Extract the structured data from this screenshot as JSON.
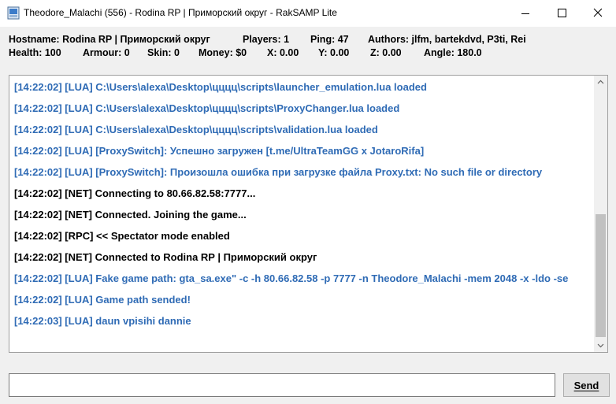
{
  "window": {
    "title": "Theodore_Malachi (556) - Rodina RP | Приморский округ - RakSAMP Lite"
  },
  "info": {
    "hostname": "Hostname: Rodina RP | Приморский округ",
    "players": "Players: 1",
    "ping": "Ping: 47",
    "authors": "Authors: jlfm, bartekdvd, P3ti, Rei",
    "health": "Health: 100",
    "armour": "Armour: 0",
    "skin": "Skin: 0",
    "money": "Money: $0",
    "x": "X: 0.00",
    "y": "Y: 0.00",
    "z": "Z: 0.00",
    "angle": "Angle: 180.0"
  },
  "log": {
    "lines": [
      {
        "text": "[14:22:02] [LUA] C:\\Users\\alexa\\Desktop\\цццц\\scripts\\launcher_emulation.lua loaded",
        "color": "#2f6bb5"
      },
      {
        "text": "[14:22:02] [LUA] C:\\Users\\alexa\\Desktop\\цццц\\scripts\\ProxyChanger.lua loaded",
        "color": "#2f6bb5"
      },
      {
        "text": "[14:22:02] [LUA] C:\\Users\\alexa\\Desktop\\цццц\\scripts\\validation.lua loaded",
        "color": "#2f6bb5"
      },
      {
        "text": "[14:22:02] [LUA] [ProxySwitch]: Успешно загружен [t.me/UltraTeamGG x JotaroRifa]",
        "color": "#2f6bb5"
      },
      {
        "text": "[14:22:02] [LUA] [ProxySwitch]: Произошла ошибка при загрузке файла Proxy.txt: No such file or directory",
        "color": "#2f6bb5"
      },
      {
        "text": "[14:22:02] [NET] Connecting to 80.66.82.58:7777...",
        "color": "#000000"
      },
      {
        "text": "[14:22:02] [NET] Connected. Joining the game...",
        "color": "#000000"
      },
      {
        "text": "[14:22:02] [RPC] << Spectator mode enabled",
        "color": "#000000"
      },
      {
        "text": "[14:22:02] [NET] Connected to Rodina RP | Приморский округ",
        "color": "#000000"
      },
      {
        "text": "[14:22:02] [LUA] Fake game path: gta_sa.exe\" -c -h 80.66.82.58 -p 7777 -n Theodore_Malachi -mem 2048 -x -ldo -se",
        "color": "#2f6bb5"
      },
      {
        "text": "[14:22:02] [LUA] Game path sended!",
        "color": "#2f6bb5"
      },
      {
        "text": "[14:22:03] [LUA] daun vpisihi dannie",
        "color": "#2f6bb5"
      }
    ]
  },
  "command": {
    "value": "",
    "send_label": "Send"
  }
}
